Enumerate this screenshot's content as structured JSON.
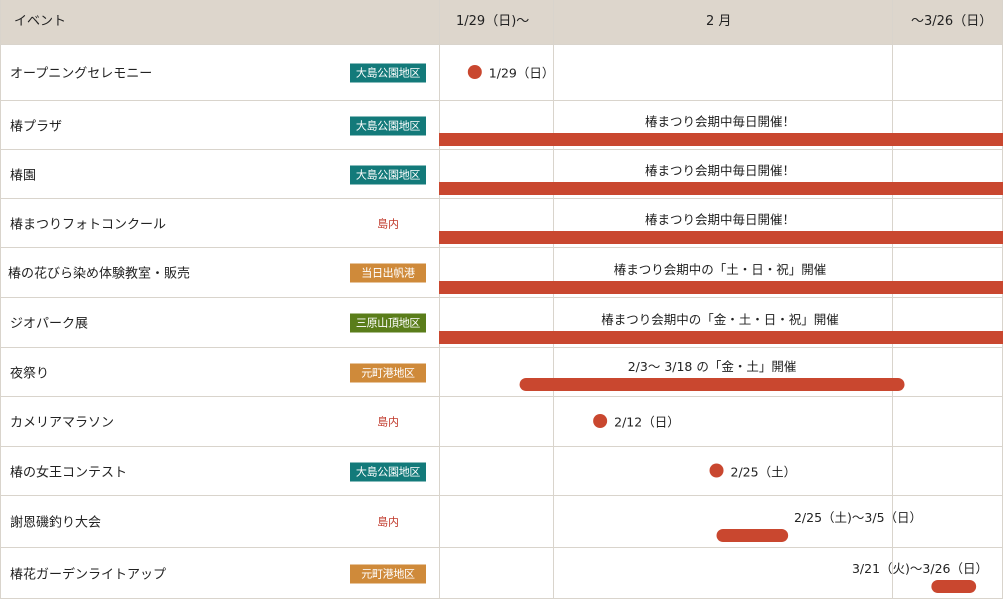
{
  "chart_data": {
    "type": "gantt",
    "header": {
      "event_col": "イベント",
      "period_cols": [
        "1/29（日)～",
        "2 月",
        "～3/26（日）"
      ]
    },
    "colors": {
      "mark": "#c9472f",
      "header_bg": "#ddd6cc",
      "teal": "#137a7a",
      "orange": "#cf8a3a",
      "green": "#5a7d1a",
      "red_text": "#c0392b"
    },
    "events": [
      {
        "name": "オープニングセレモニー",
        "location": "大島公園地区",
        "location_style": "teal",
        "kind": "point",
        "date": "2023-01-29",
        "label": "1/29（日）"
      },
      {
        "name": "椿プラザ",
        "location": "大島公園地区",
        "location_style": "teal",
        "kind": "range",
        "start": "2023-01-29",
        "end": "2023-03-26",
        "open_start": true,
        "open_end": true,
        "label": "椿まつり会期中毎日開催！"
      },
      {
        "name": "椿園",
        "location": "大島公園地区",
        "location_style": "teal",
        "kind": "range",
        "start": "2023-01-29",
        "end": "2023-03-26",
        "open_start": true,
        "open_end": true,
        "label": "椿まつり会期中毎日開催！"
      },
      {
        "name": "椿まつりフォトコンクール",
        "location": "島内",
        "location_style": "plain",
        "kind": "range",
        "start": "2023-01-29",
        "end": "2023-03-26",
        "open_start": true,
        "open_end": true,
        "label": "椿まつり会期中毎日開催！"
      },
      {
        "name": "椿の花びら染め体験教室・販売",
        "location": "当日出帆港",
        "location_style": "orange",
        "kind": "range",
        "start": "2023-01-29",
        "end": "2023-03-26",
        "open_start": true,
        "open_end": true,
        "label": "椿まつり会期中の「土・日・祝」開催"
      },
      {
        "name": "ジオパーク展",
        "location": "三原山頂地区",
        "location_style": "green",
        "kind": "range",
        "start": "2023-01-29",
        "end": "2023-03-26",
        "open_start": true,
        "open_end": true,
        "label": "椿まつり会期中の「金・土・日・祝」開催"
      },
      {
        "name": "夜祭り",
        "location": "元町港地区",
        "location_style": "orange",
        "kind": "range",
        "start": "2023-02-03",
        "end": "2023-03-18",
        "label": "2/3～ 3/18 の「金・土」開催"
      },
      {
        "name": "カメリアマラソン",
        "location": "島内",
        "location_style": "plain",
        "kind": "point",
        "date": "2023-02-12",
        "label": "2/12（日）"
      },
      {
        "name": "椿の女王コンテスト",
        "location": "大島公園地区",
        "location_style": "teal",
        "kind": "point",
        "date": "2023-02-25",
        "label": "2/25（土）"
      },
      {
        "name": "謝恩磯釣り大会",
        "location": "島内",
        "location_style": "plain",
        "kind": "range",
        "start": "2023-02-25",
        "end": "2023-03-05",
        "label": "2/25（土)～3/5（日）"
      },
      {
        "name": "椿花ガーデンライトアップ",
        "location": "元町港地区",
        "location_style": "orange",
        "kind": "range",
        "start": "2023-03-21",
        "end": "2023-03-26",
        "label": "3/21（火)～3/26（日）"
      }
    ]
  }
}
